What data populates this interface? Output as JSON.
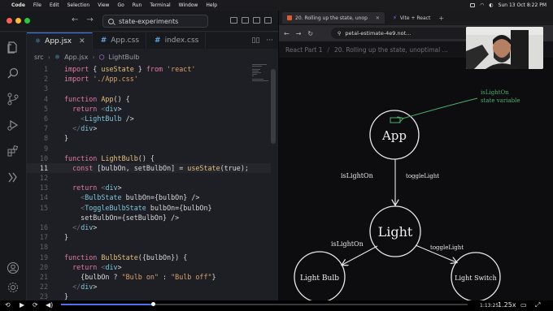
{
  "menubar": {
    "app": "Code",
    "items": [
      "File",
      "Edit",
      "Selection",
      "View",
      "Go",
      "Run",
      "Terminal",
      "Window",
      "Help"
    ],
    "datetime": "Sun 13 Oct  8:22 PM"
  },
  "editor": {
    "search_text": "state-experiments",
    "tabs": [
      {
        "label": "App.jsx",
        "kind": "react",
        "active": true
      },
      {
        "label": "App.css",
        "kind": "css",
        "active": false
      },
      {
        "label": "index.css",
        "kind": "css",
        "active": false
      }
    ],
    "breadcrumb": [
      "src",
      "App.jsx",
      "LightBulb"
    ],
    "current_line": 11,
    "lines": [
      {
        "n": "1",
        "code": "import { useState } from 'react'"
      },
      {
        "n": "2",
        "code": "import './App.css'"
      },
      {
        "n": "3",
        "code": ""
      },
      {
        "n": "4",
        "code": "function App() {"
      },
      {
        "n": "5",
        "code": "  return <div>"
      },
      {
        "n": "6",
        "code": "    <LightBulb />"
      },
      {
        "n": "7",
        "code": "  </div>"
      },
      {
        "n": "8",
        "code": "}"
      },
      {
        "n": "9",
        "code": ""
      },
      {
        "n": "10",
        "code": "function LightBulb() {"
      },
      {
        "n": "11",
        "code": "  const [bulbOn, setBulbOn] = useState(true);"
      },
      {
        "n": "12",
        "code": ""
      },
      {
        "n": "13",
        "code": "  return <div>"
      },
      {
        "n": "14",
        "code": "    <BulbState bulbOn={bulbOn} />"
      },
      {
        "n": "15",
        "code": "    <ToggleBulbState bulbOn={bulbOn}"
      },
      {
        "n": "",
        "code": "    setBulbOn={setBulbOn} />"
      },
      {
        "n": "16",
        "code": "  </div>"
      },
      {
        "n": "17",
        "code": "}"
      },
      {
        "n": "18",
        "code": ""
      },
      {
        "n": "19",
        "code": "function BulbState({bulbOn}) {"
      },
      {
        "n": "20",
        "code": "  return <div>"
      },
      {
        "n": "21",
        "code": "    {bulbOn ? \"Bulb on\" : \"Bulb off\"}"
      },
      {
        "n": "22",
        "code": "  </div>"
      },
      {
        "n": "23",
        "code": "}"
      }
    ]
  },
  "browser": {
    "tabs": [
      {
        "label": "20. Rolling up the state, unop",
        "active": true
      },
      {
        "label": "Vite + React",
        "active": false
      }
    ],
    "url": "petal-estimate-4e9.not...",
    "page_tabs": [
      "React Part 1",
      "20. Rolling up the state, unoptimal ..."
    ],
    "diagram": {
      "nodes": [
        {
          "id": "app",
          "label": "App"
        },
        {
          "id": "light",
          "label": "Light"
        },
        {
          "id": "bulb",
          "label": "Light Bulb"
        },
        {
          "id": "switch",
          "label": "Light Switch"
        }
      ],
      "edge_labels": {
        "app_light_left": "isLightOn",
        "app_light_right": "toggleLight",
        "light_bulb": "isLightOn",
        "light_switch": "toggleLight"
      },
      "annotation": [
        "isLightOn",
        "state variable"
      ],
      "annotation_color": "#4caf6a"
    }
  },
  "player": {
    "time": "1:13:25",
    "speed": "1.25x",
    "progress": 0.225
  },
  "colors": {
    "accent": "#4a8cff",
    "keyword": "#e37aa2",
    "string": "#d9a26a",
    "tag": "#7ec6df"
  }
}
